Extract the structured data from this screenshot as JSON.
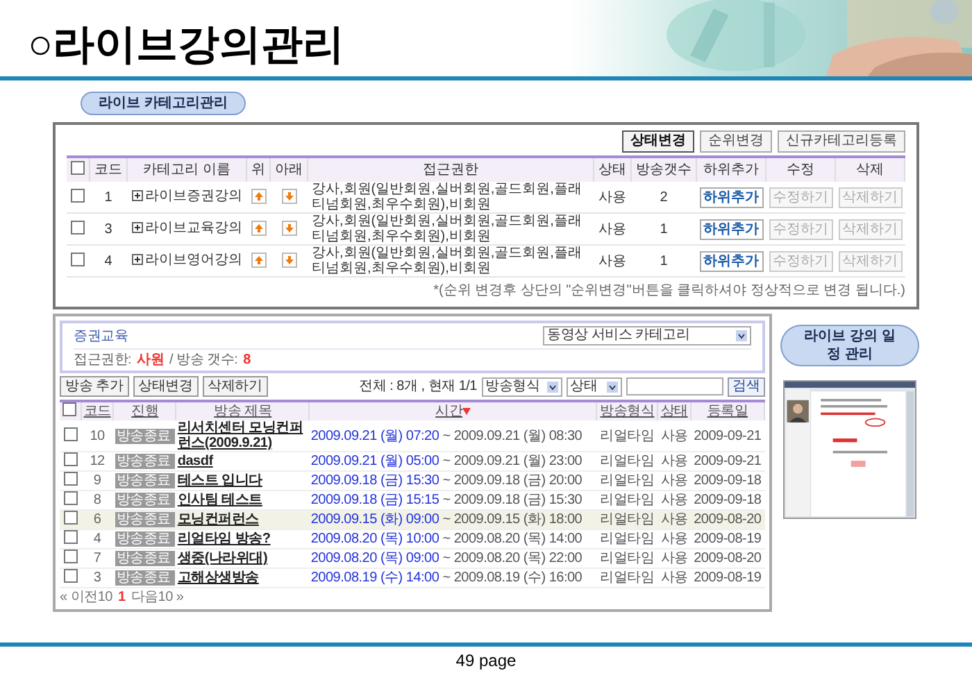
{
  "slide_title": "○라이브강의관리",
  "category_section": {
    "heading": "라이브 카테고리관리",
    "toolbar": [
      {
        "label": "상태변경",
        "active": true
      },
      {
        "label": "순위변경",
        "active": false
      },
      {
        "label": "신규카테고리등록",
        "active": false
      }
    ],
    "header_checked": false,
    "columns": [
      "코드",
      "카테고리 이름",
      "위",
      "아래",
      "접근권한",
      "상태",
      "방송갯수",
      "하위추가",
      "수정",
      "삭제"
    ],
    "rows": [
      {
        "checked": false,
        "code": "1",
        "name": "라이브증권강의",
        "access": "강사,회원(일반회원,실버회원,골드회원,플래티넘회원,최우수회원),비회원",
        "status": "사용",
        "count": "2",
        "actions": [
          {
            "label": "하위추가",
            "disabled": false
          },
          {
            "label": "수정하기",
            "disabled": true
          },
          {
            "label": "삭제하기",
            "disabled": true
          }
        ]
      },
      {
        "checked": false,
        "code": "3",
        "name": "라이브교육강의",
        "access": "강사,회원(일반회원,실버회원,골드회원,플래티넘회원,최우수회원),비회원",
        "status": "사용",
        "count": "1",
        "actions": [
          {
            "label": "하위추가",
            "disabled": false
          },
          {
            "label": "수정하기",
            "disabled": true
          },
          {
            "label": "삭제하기",
            "disabled": true
          }
        ]
      },
      {
        "checked": false,
        "code": "4",
        "name": "라이브영어강의",
        "access": "강사,회원(일반회원,실버회원,골드회원,플래티넘회원,최우수회원),비회원",
        "status": "사용",
        "count": "1",
        "actions": [
          {
            "label": "하위추가",
            "disabled": false
          },
          {
            "label": "수정하기",
            "disabled": true
          },
          {
            "label": "삭제하기",
            "disabled": true
          }
        ]
      }
    ],
    "note": "*(순위 변경후 상단의 \"순위변경\"버튼을 클릭하셔야 정상적으로 변경 됩니다.)"
  },
  "broadcast_panel": {
    "title": "증권교육",
    "category_select": "동영상 서비스 카테고리",
    "access_label": "접근권한:",
    "access_value": "사원",
    "count_label": "/ 방송 갯수:",
    "count_value": "8",
    "buttons": [
      "방송 추가",
      "상태변경",
      "삭제하기"
    ],
    "summary": "전체 : 8개 , 현재 1/1",
    "format_select": "방송형식",
    "status_select": "상태",
    "search_button": "검색",
    "header_checked": false,
    "columns": [
      "코드",
      "진행",
      "방송 제목",
      "시간",
      "방송형식",
      "상태",
      "등록일"
    ],
    "rows": [
      {
        "checked": false,
        "selected": false,
        "code": "10",
        "progress": "방송종료",
        "title": "리서치센터 모닝컨퍼런스(2009.9.21)",
        "start": "2009.09.21 (월) 07:20",
        "end": "~ 2009.09.21 (월) 08:30",
        "format": "리얼타임",
        "status": "사용",
        "date": "2009-09-21"
      },
      {
        "checked": false,
        "selected": false,
        "code": "12",
        "progress": "방송종료",
        "title": "dasdf",
        "start": "2009.09.21 (월) 05:00",
        "end": "~ 2009.09.21 (월) 23:00",
        "format": "리얼타임",
        "status": "사용",
        "date": "2009-09-21"
      },
      {
        "checked": false,
        "selected": false,
        "code": "9",
        "progress": "방송종료",
        "title": "테스트 입니다",
        "start": "2009.09.18 (금) 15:30",
        "end": "~ 2009.09.18 (금) 20:00",
        "format": "리얼타임",
        "status": "사용",
        "date": "2009-09-18"
      },
      {
        "checked": false,
        "selected": false,
        "code": "8",
        "progress": "방송종료",
        "title": "인사팀 테스트",
        "start": "2009.09.18 (금) 15:15",
        "end": "~ 2009.09.18 (금) 15:30",
        "format": "리얼타임",
        "status": "사용",
        "date": "2009-09-18"
      },
      {
        "checked": false,
        "selected": true,
        "code": "6",
        "progress": "방송종료",
        "title": "모닝컨퍼런스",
        "start": "2009.09.15 (화) 09:00",
        "end": "~ 2009.09.15 (화) 18:00",
        "format": "리얼타임",
        "status": "사용",
        "date": "2009-08-20"
      },
      {
        "checked": false,
        "selected": false,
        "code": "4",
        "progress": "방송종료",
        "title": "리얼타임 방송?",
        "start": "2009.08.20 (목) 10:00",
        "end": "~ 2009.08.20 (목) 14:00",
        "format": "리얼타임",
        "status": "사용",
        "date": "2009-08-19"
      },
      {
        "checked": false,
        "selected": false,
        "code": "7",
        "progress": "방송종료",
        "title": "생중(나라위대)",
        "start": "2009.08.20 (목) 09:00",
        "end": "~ 2009.08.20 (목) 22:00",
        "format": "리얼타임",
        "status": "사용",
        "date": "2009-08-20"
      },
      {
        "checked": false,
        "selected": false,
        "code": "3",
        "progress": "방송종료",
        "title": "고해상생방송",
        "start": "2009.08.19 (수) 14:00",
        "end": "~ 2009.08.19 (수) 16:00",
        "format": "리얼타임",
        "status": "사용",
        "date": "2009-08-19"
      }
    ],
    "pagination": {
      "prev": "« 이전10",
      "pages": [
        {
          "label": "1",
          "selected": true
        }
      ],
      "next": "다음10 »"
    }
  },
  "schedule_section": {
    "heading": "라이브 강의 일정 관리"
  },
  "page_number": "49 page"
}
